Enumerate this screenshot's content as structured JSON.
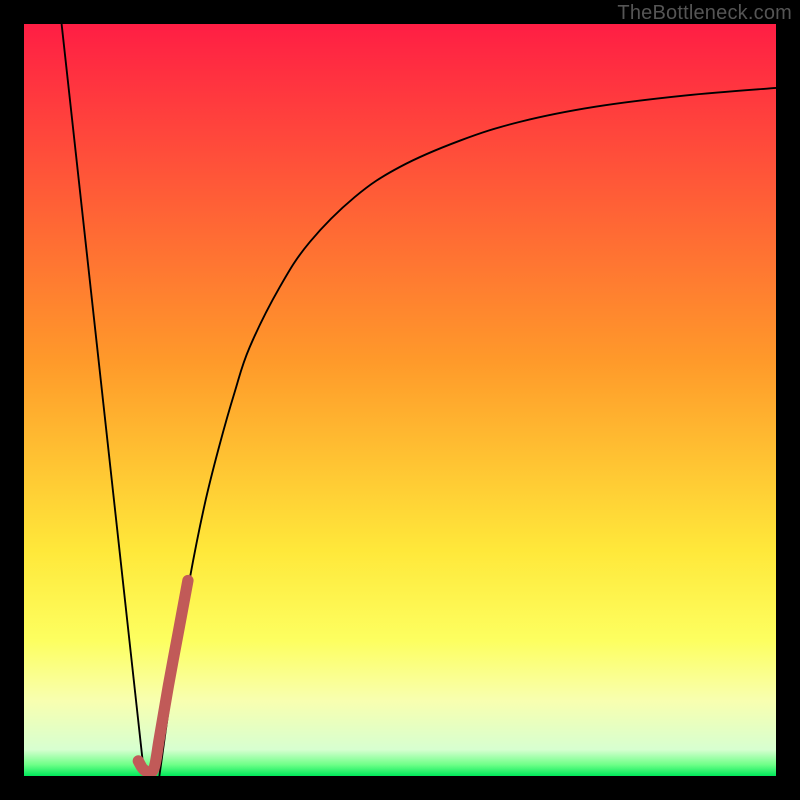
{
  "watermark": {
    "text": "TheBottleneck.com"
  },
  "colors": {
    "frame": "#000000",
    "curve_black": "#000000",
    "curve_red": "#c15a58",
    "gradient_stops": [
      {
        "offset": 0,
        "color": "#ff1e44"
      },
      {
        "offset": 0.45,
        "color": "#ff9a2a"
      },
      {
        "offset": 0.7,
        "color": "#ffe83a"
      },
      {
        "offset": 0.82,
        "color": "#fdff60"
      },
      {
        "offset": 0.9,
        "color": "#f8ffb0"
      },
      {
        "offset": 0.965,
        "color": "#d7ffd0"
      },
      {
        "offset": 0.985,
        "color": "#6eff88"
      },
      {
        "offset": 1.0,
        "color": "#00e85a"
      }
    ]
  },
  "chart_data": {
    "type": "line",
    "title": "",
    "xlabel": "",
    "ylabel": "",
    "xlim": [
      0,
      100
    ],
    "ylim": [
      0,
      100
    ],
    "grid": false,
    "series": [
      {
        "name": "left-descending-line",
        "x": [
          5,
          16
        ],
        "y": [
          100,
          0
        ]
      },
      {
        "name": "log-like-curve",
        "x": [
          18,
          20,
          22,
          24,
          26,
          28,
          30,
          34,
          38,
          44,
          50,
          58,
          66,
          76,
          88,
          100
        ],
        "y": [
          0,
          14,
          26,
          36,
          44,
          51,
          57,
          65,
          71,
          77,
          81,
          84.5,
          87,
          89,
          90.5,
          91.5
        ]
      },
      {
        "name": "highlight-segment",
        "x": [
          15.2,
          16.0,
          17.2,
          18.0,
          19.2,
          20.5,
          21.8
        ],
        "y": [
          2.0,
          0.8,
          0.8,
          5.0,
          12.0,
          19.0,
          26.0
        ]
      }
    ],
    "annotations": []
  }
}
